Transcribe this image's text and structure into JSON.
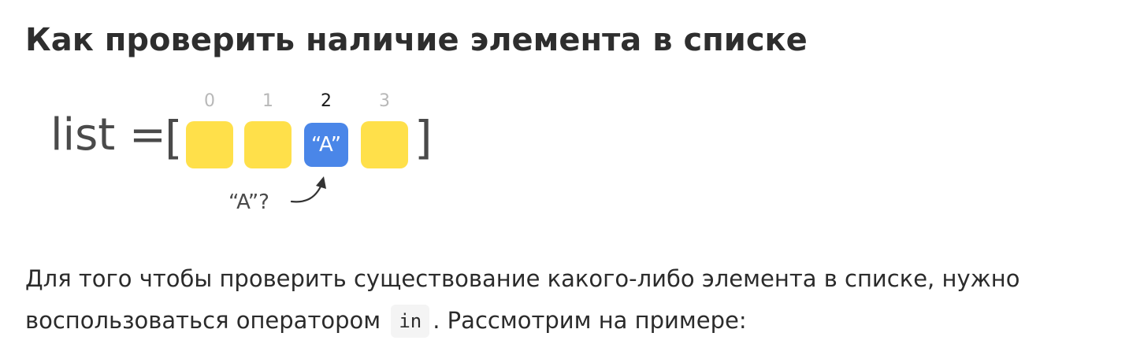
{
  "heading": "Как проверить наличие элемента в списке",
  "diagram": {
    "list_label": "list =",
    "open_bracket": "[",
    "close_bracket": "]",
    "indices": [
      "0",
      "1",
      "2",
      "3"
    ],
    "cells": [
      "",
      "",
      "“A”",
      ""
    ],
    "highlight_index": 2,
    "query_label": "“A”?",
    "colors": {
      "cell": "#ffe04a",
      "highlight": "#4a86e8"
    }
  },
  "paragraph": {
    "part1": "Для того чтобы проверить существование какого-либо элемента в списке, нужно воспользоваться оператором",
    "code": "in",
    "part2": ". Рассмотрим на примере:"
  }
}
